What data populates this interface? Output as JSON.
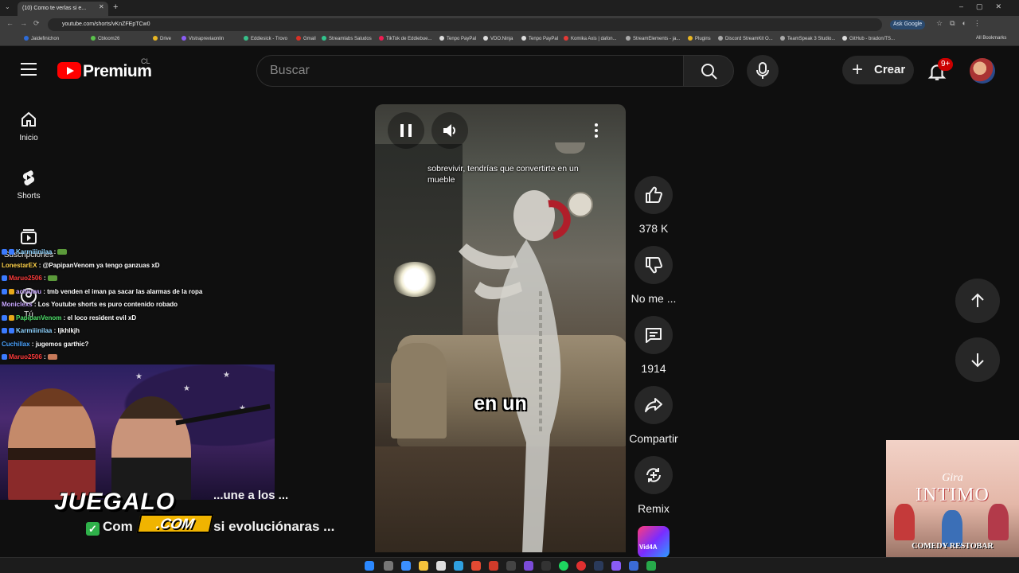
{
  "browser": {
    "tab_title": "(10) Como te verlas si e...",
    "url": "youtube.com/shorts/vKnZFEpTCw0",
    "ask_google": "Ask Google",
    "bookmarks": [
      "Jaidefinichon",
      "Cbloom26",
      "Drive",
      "Vistrapreviaonlin",
      "Eddiesick - Trovo",
      "Gmail",
      "Streamlabs Saludos",
      "TikTok de Eddiebue...",
      "Tenpo PayPal",
      "VDO.Ninja",
      "Tenpo PayPal",
      "Komika Axis | dafon...",
      "StreamElements - ja...",
      "Plugins",
      "Discord StreamKit O...",
      "TeamSpeak 3 Studio...",
      "GitHub - bradon/TS...",
      "All Bookmarks"
    ]
  },
  "header": {
    "logo_text": "Premium",
    "region": "CL",
    "search_placeholder": "Buscar",
    "create_label": "Crear",
    "notification_count": "9+"
  },
  "sidebar": {
    "items": [
      {
        "label": "Inicio",
        "icon": "home-icon"
      },
      {
        "label": "Shorts",
        "icon": "shorts-icon"
      },
      {
        "label": "Suscripciones",
        "icon": "subscriptions-icon"
      },
      {
        "label": "Tú",
        "icon": "you-icon"
      }
    ]
  },
  "stream_chat": [
    {
      "user": "Karmiiinilaa",
      "message": "",
      "user_color": "#8fd3ff"
    },
    {
      "user": "LonestarEX",
      "message": "@PapipanVenom ya tengo ganzuas xD",
      "user_color": "#ffd24a"
    },
    {
      "user": "Maruo2506",
      "message": "",
      "user_color": "#ff3b3b"
    },
    {
      "user": "achiuwu",
      "message": "tmb venden el iman pa sacar las alarmas de la ropa",
      "user_color": "#c9a7ff"
    },
    {
      "user": "Moniclexs",
      "message": "Los Youtube shorts es puro contenido robado",
      "user_color": "#c9a7ff"
    },
    {
      "user": "PapipanVenom",
      "message": "el loco resident evil xD",
      "user_color": "#4ee06a"
    },
    {
      "user": "Karmiiinilaa",
      "message": "ljkhlkjh",
      "user_color": "#8fd3ff"
    },
    {
      "user": "Cuchillax",
      "message": "jugemos garthic?",
      "user_color": "#4aa3ff"
    },
    {
      "user": "Maruo2506",
      "message": "",
      "user_color": "#ff3b3b"
    }
  ],
  "overlay": {
    "brand_top": "JUEGALO",
    "brand_bottom": ".COM",
    "title_line_a": "...une a los ...",
    "title_line_b_start": "Com",
    "title_line_b_end": "s si evoluciónaras ..."
  },
  "short": {
    "caption_top": "sobrevivir, tendrías que convertirte en un mueble",
    "caption_big": "en un"
  },
  "actions": {
    "likes": "378 K",
    "dislike_label": "No me ...",
    "comments": "1914",
    "share_label": "Compartir",
    "remix_label": "Remix",
    "channel_thumb_text": "Vid4A"
  },
  "poster": {
    "script_title": "Gira",
    "title": "INTIMO",
    "venue": "COMEDY RESTOBAR"
  },
  "colors": {
    "youtube_red": "#ff0000",
    "badge_red": "#cc0000",
    "background": "#0f0f0f",
    "button_bg": "#272727"
  }
}
